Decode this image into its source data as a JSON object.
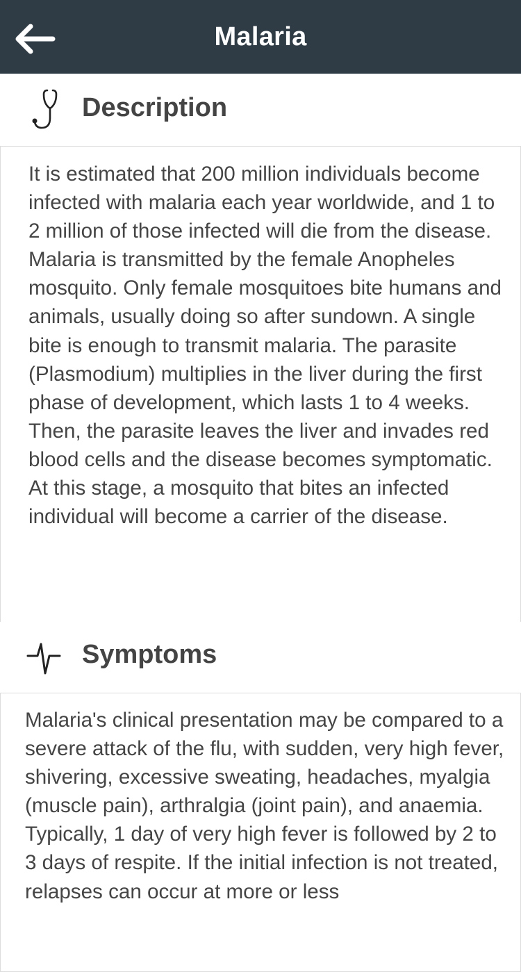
{
  "header": {
    "title": "Malaria",
    "back_icon": "arrow-left-icon"
  },
  "sections": {
    "description": {
      "icon": "stethoscope-icon",
      "title": "Description",
      "body": "It is estimated that 200 million individuals become infected with malaria each year worldwide, and 1 to 2 million of those infected will die from the disease. Malaria is transmitted by the female Anopheles mosquito. Only female mosquitoes bite humans and animals, usually doing so after sundown. A single bite is enough to transmit malaria. The parasite (Plasmodium) multiplies in the liver during the first phase of development, which lasts 1 to 4 weeks. Then, the parasite leaves the liver and invades red blood cells and the disease becomes symptomatic. At this stage, a mosquito that bites an infected individual will become a carrier of the disease."
    },
    "symptoms": {
      "icon": "heartbeat-pulse-icon",
      "title": "Symptoms",
      "body": "Malaria's clinical presentation may be compared to a severe attack of the flu, with sudden, very high fever, shivering, excessive sweating, headaches, myalgia (muscle pain), arthralgia (joint pain), and anaemia. Typically, 1 day of very high fever is followed by 2 to 3 days of respite. If the initial infection is not treated, relapses can occur at more or less"
    }
  },
  "colors": {
    "app_bar": "#2f3b45",
    "title_text": "#ffffff",
    "body_text": "#454545",
    "card_border": "#dcdcdc"
  }
}
